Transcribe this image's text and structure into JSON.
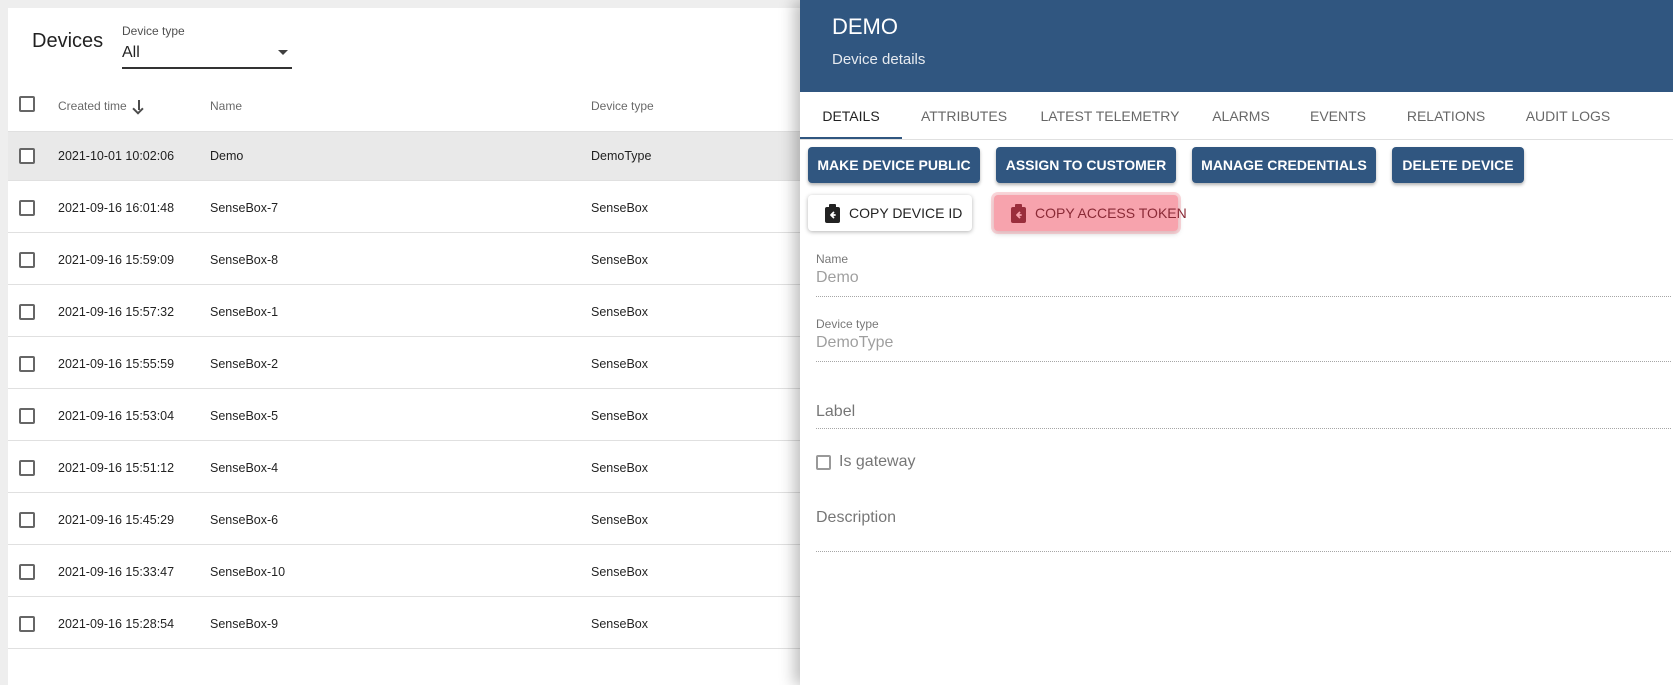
{
  "list": {
    "title": "Devices",
    "filter": {
      "label": "Device type",
      "value": "All"
    },
    "columns": {
      "created": "Created time",
      "name": "Name",
      "type": "Device type"
    },
    "rows": [
      {
        "created": "2021-10-01 10:02:06",
        "name": "Demo",
        "type": "DemoType",
        "selected": true
      },
      {
        "created": "2021-09-16 16:01:48",
        "name": "SenseBox-7",
        "type": "SenseBox"
      },
      {
        "created": "2021-09-16 15:59:09",
        "name": "SenseBox-8",
        "type": "SenseBox"
      },
      {
        "created": "2021-09-16 15:57:32",
        "name": "SenseBox-1",
        "type": "SenseBox"
      },
      {
        "created": "2021-09-16 15:55:59",
        "name": "SenseBox-2",
        "type": "SenseBox"
      },
      {
        "created": "2021-09-16 15:53:04",
        "name": "SenseBox-5",
        "type": "SenseBox"
      },
      {
        "created": "2021-09-16 15:51:12",
        "name": "SenseBox-4",
        "type": "SenseBox"
      },
      {
        "created": "2021-09-16 15:45:29",
        "name": "SenseBox-6",
        "type": "SenseBox"
      },
      {
        "created": "2021-09-16 15:33:47",
        "name": "SenseBox-10",
        "type": "SenseBox"
      },
      {
        "created": "2021-09-16 15:28:54",
        "name": "SenseBox-9",
        "type": "SenseBox"
      }
    ]
  },
  "details": {
    "title": "DEMO",
    "subtitle": "Device details",
    "tabs": [
      "Details",
      "Attributes",
      "Latest telemetry",
      "Alarms",
      "Events",
      "Relations",
      "Audit logs"
    ],
    "active_tab": "Details",
    "actions": {
      "make_public": "Make device public",
      "assign_customer": "Assign to customer",
      "manage_credentials": "Manage credentials",
      "delete": "Delete device",
      "copy_id": "Copy device ID",
      "copy_token": "Copy access token"
    },
    "form": {
      "name_label": "Name",
      "name_value": "Demo",
      "type_label": "Device type",
      "type_value": "DemoType",
      "label_placeholder": "Label",
      "gateway_label": "Is gateway",
      "description_placeholder": "Description"
    }
  },
  "colors": {
    "primary": "#305680",
    "highlight": "#f7a3ad",
    "selected_row": "#e9e9e9"
  },
  "icons": {
    "sort": "arrow-down-icon",
    "copy": "clipboard-arrow-icon",
    "dropdown": "caret-down-icon"
  }
}
